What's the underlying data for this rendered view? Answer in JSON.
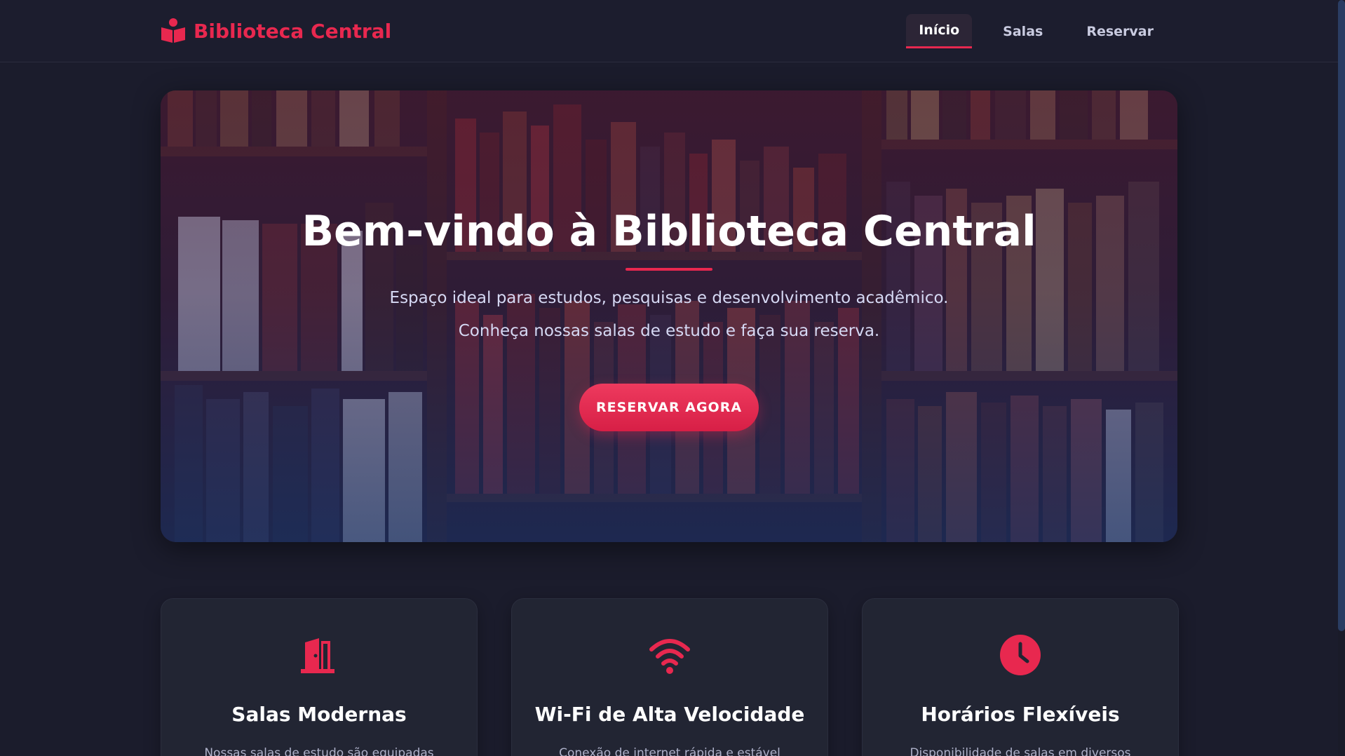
{
  "header": {
    "brand": "Biblioteca Central",
    "brand_icon": "book-reader-icon",
    "nav": [
      {
        "label": "Início",
        "active": true
      },
      {
        "label": "Salas",
        "active": false
      },
      {
        "label": "Reservar",
        "active": false
      }
    ]
  },
  "hero": {
    "title": "Bem-vindo à Biblioteca Central",
    "subtitle_line1": "Espaço ideal para estudos, pesquisas e desenvolvimento acadêmico.",
    "subtitle_line2": "Conheça nossas salas de estudo e faça sua reserva.",
    "cta_label": "RESERVAR AGORA",
    "background": "library-bookshelf-photo"
  },
  "features": [
    {
      "icon": "door-open-icon",
      "title": "Salas Modernas",
      "text": "Nossas salas de estudo são equipadas"
    },
    {
      "icon": "wifi-icon",
      "title": "Wi-Fi de Alta Velocidade",
      "text": "Conexão de internet rápida e estável"
    },
    {
      "icon": "clock-icon",
      "title": "Horários Flexíveis",
      "text": "Disponibilidade de salas em diversos"
    }
  ],
  "colors": {
    "accent": "#e8284f",
    "background": "#1b1c2c",
    "header": "#1c1d2e",
    "card": "#222533"
  }
}
